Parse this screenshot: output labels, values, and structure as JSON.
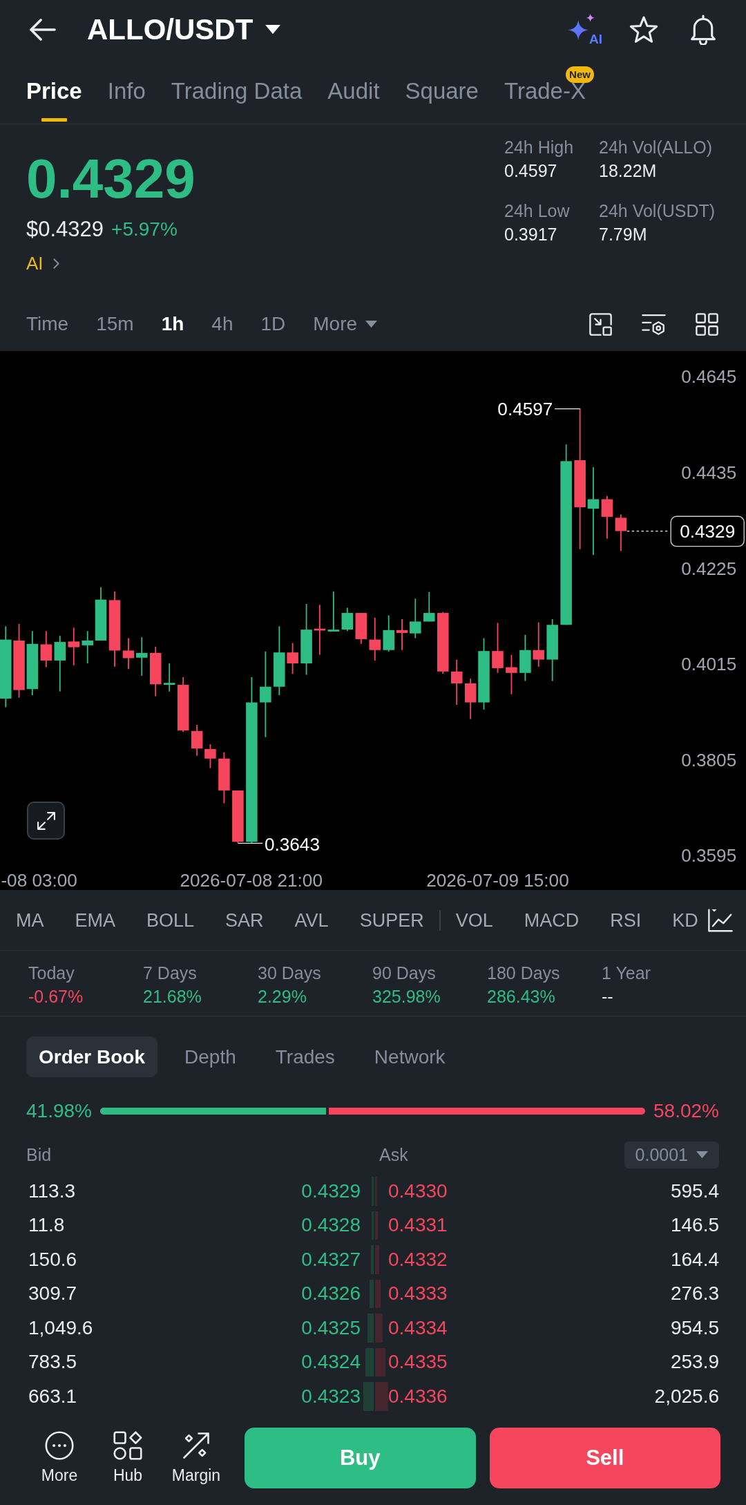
{
  "header": {
    "title": "ALLO/USDT",
    "ai_badge": "AI",
    "favorited": false
  },
  "tabs": [
    {
      "label": "Price",
      "selected": true
    },
    {
      "label": "Info",
      "selected": false
    },
    {
      "label": "Trading Data",
      "selected": false
    },
    {
      "label": "Audit",
      "selected": false
    },
    {
      "label": "Square",
      "selected": false
    },
    {
      "label": "Trade-X",
      "selected": false,
      "badge": "New"
    }
  ],
  "ticker": {
    "price": "0.4329",
    "rising": true,
    "usd_price": "$0.4329",
    "change": "+5.97%",
    "ai_link": "AI",
    "stats": [
      {
        "label": "24h High",
        "value": "0.4597"
      },
      {
        "label": "24h Vol(ALLO)",
        "value": "18.22M"
      },
      {
        "label": "24h Low",
        "value": "0.3917"
      },
      {
        "label": "24h Vol(USDT)",
        "value": "7.79M"
      }
    ]
  },
  "intervals": [
    {
      "label": "Time",
      "kind": "option",
      "selected": false
    },
    {
      "label": "15m",
      "kind": "option",
      "selected": false
    },
    {
      "label": "1h",
      "kind": "option",
      "selected": true
    },
    {
      "label": "4h",
      "kind": "option",
      "selected": false
    },
    {
      "label": "1D",
      "kind": "option",
      "selected": false
    },
    {
      "label": "More",
      "kind": "menu",
      "selected": false
    }
  ],
  "chart": {
    "price_axis": [
      "0.4645",
      "0.4435",
      "0.4225",
      "0.4015",
      "0.3805",
      "0.3595"
    ],
    "time_axis": [
      "-08 03:00",
      "2026-07-08 21:00",
      "2026-07-09 15:00"
    ],
    "high_label": "0.4597",
    "low_label": "0.3643",
    "last_price": "0.4329"
  },
  "indicators": {
    "main": [
      {
        "label": "MA",
        "selected": false
      },
      {
        "label": "EMA",
        "selected": false
      },
      {
        "label": "BOLL",
        "selected": false
      },
      {
        "label": "SAR",
        "selected": false
      },
      {
        "label": "AVL",
        "selected": false
      },
      {
        "label": "SUPER",
        "selected": false
      }
    ],
    "sub": [
      {
        "label": "VOL",
        "selected": false
      },
      {
        "label": "MACD",
        "selected": false
      },
      {
        "label": "RSI",
        "selected": false
      },
      {
        "label": "KD",
        "selected": false
      }
    ]
  },
  "performance": [
    {
      "period": "Today",
      "change": "-0.67%",
      "color": "#f6465d"
    },
    {
      "period": "7 Days",
      "change": "21.68%",
      "color": "#2ebd85"
    },
    {
      "period": "30 Days",
      "change": "2.29%",
      "color": "#2ebd85"
    },
    {
      "period": "90 Days",
      "change": "325.98%",
      "color": "#2ebd85"
    },
    {
      "period": "180 Days",
      "change": "286.43%",
      "color": "#2ebd85"
    },
    {
      "period": "1 Year",
      "change": "--",
      "color": "#eaecef"
    }
  ],
  "order_book": {
    "tabs": [
      {
        "label": "Order Book",
        "selected": true
      },
      {
        "label": "Depth",
        "selected": false
      },
      {
        "label": "Trades",
        "selected": false
      },
      {
        "label": "Network",
        "selected": false
      }
    ],
    "bid_share": "41.98%",
    "ask_share": "58.02%",
    "level": 0.4198,
    "bid_heading": "Bid",
    "ask_heading": "Ask",
    "precision": "0.0001",
    "rows": [
      {
        "bid": {
          "amount": "113.3",
          "price": "0.4329"
        },
        "ask": {
          "price": "0.4330",
          "amount": "595.4"
        }
      },
      {
        "bid": {
          "amount": "11.8",
          "price": "0.4328"
        },
        "ask": {
          "price": "0.4331",
          "amount": "146.5"
        }
      },
      {
        "bid": {
          "amount": "150.6",
          "price": "0.4327"
        },
        "ask": {
          "price": "0.4332",
          "amount": "164.4"
        }
      },
      {
        "bid": {
          "amount": "309.7",
          "price": "0.4326"
        },
        "ask": {
          "price": "0.4333",
          "amount": "276.3"
        }
      },
      {
        "bid": {
          "amount": "1,049.6",
          "price": "0.4325"
        },
        "ask": {
          "price": "0.4334",
          "amount": "954.5"
        }
      },
      {
        "bid": {
          "amount": "783.5",
          "price": "0.4324"
        },
        "ask": {
          "price": "0.4335",
          "amount": "253.9"
        }
      },
      {
        "bid": {
          "amount": "663.1",
          "price": "0.4323"
        },
        "ask": {
          "price": "0.4336",
          "amount": "2,025.6"
        }
      }
    ]
  },
  "actions": {
    "shortcuts": [
      {
        "label": "More",
        "kind": "more"
      },
      {
        "label": "Hub",
        "kind": "hub"
      },
      {
        "label": "Margin",
        "kind": "margin"
      }
    ],
    "buy": "Buy",
    "sell": "Sell"
  }
}
